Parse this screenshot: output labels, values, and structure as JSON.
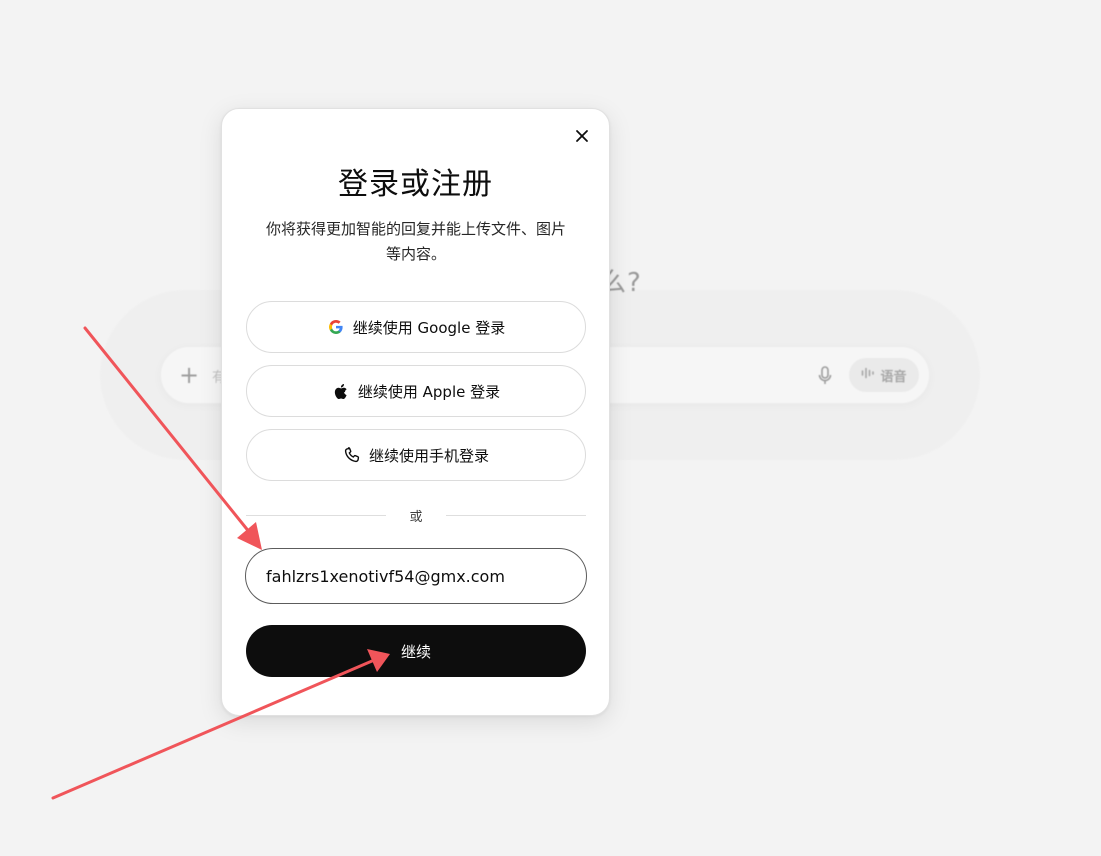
{
  "background": {
    "heading_fragment": "么?",
    "composer_placeholder": "有",
    "voice_label": "语音"
  },
  "modal": {
    "title": "登录或注册",
    "subtitle": "你将获得更加智能的回复并能上传文件、图片等内容。",
    "google_label": "继续使用 Google 登录",
    "apple_label": "继续使用 Apple 登录",
    "phone_label": "继续使用手机登录",
    "divider_text": "或",
    "email_value": "fahlzrs1xenotivf54@gmx.com",
    "continue_label": "继续"
  },
  "icons": {
    "close": "close-icon",
    "google": "google-icon",
    "apple": "apple-icon",
    "phone": "phone-icon",
    "mic": "microphone-icon",
    "voice": "waveform-icon",
    "plus": "plus-icon"
  },
  "colors": {
    "page_bg": "#f3f3f3",
    "primary_button": "#0d0d0d",
    "annotation_arrow": "#f0555a"
  }
}
